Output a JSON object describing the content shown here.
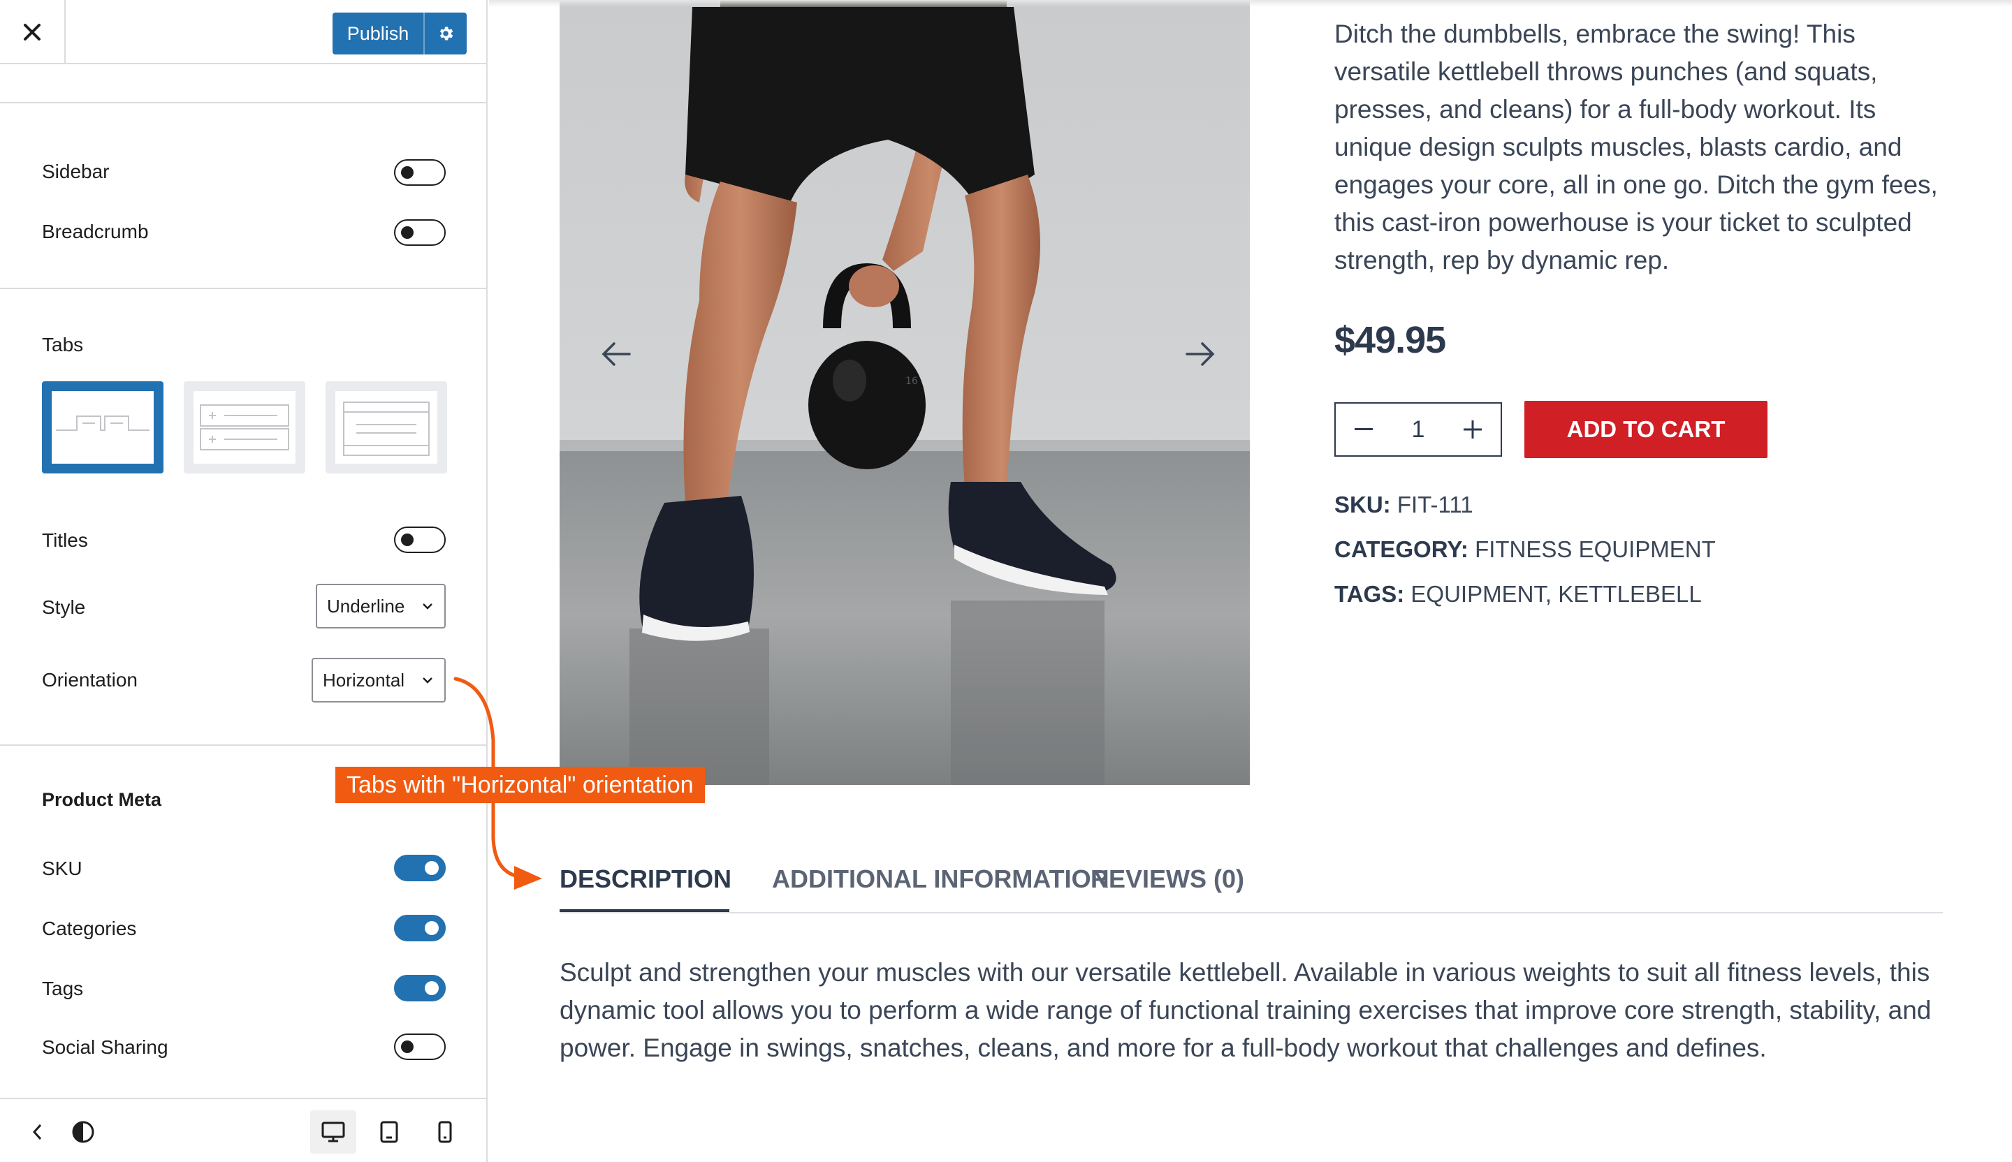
{
  "header": {
    "publish_label": "Publish"
  },
  "sidebar": {
    "sidebar_label": "Sidebar",
    "breadcrumb_label": "Breadcrumb",
    "tabs_title": "Tabs",
    "titles_label": "Titles",
    "style_label": "Style",
    "style_value": "Underline",
    "orientation_label": "Orientation",
    "orientation_value": "Horizontal",
    "product_meta_title": "Product Meta",
    "sku_label": "SKU",
    "categories_label": "Categories",
    "tags_label": "Tags",
    "social_label": "Social Sharing",
    "toggles": {
      "sidebar": false,
      "breadcrumb": false,
      "titles": false,
      "sku": true,
      "categories": true,
      "tags": true,
      "social_sharing": false
    },
    "tabs_layout_selected": 1
  },
  "footer": {
    "active_device": "desktop"
  },
  "product": {
    "description": "Ditch the dumbbells, embrace the swing! This versatile kettlebell throws punches (and squats, presses, and cleans) for a full-body workout. Its unique design sculpts muscles, blasts cardio, and engages your core, all in one go. Ditch the gym fees, this cast-iron powerhouse is your ticket to sculpted strength, rep by dynamic rep.",
    "price": "$49.95",
    "quantity": "1",
    "add_to_cart": "ADD TO CART",
    "sku_key": "SKU:",
    "sku_value": "FIT-111",
    "category_key": "CATEGORY:",
    "category_value": "FITNESS EQUIPMENT",
    "tags_key": "TAGS:",
    "tags_value": "EQUIPMENT, KETTLEBELL",
    "weight_engraving": "16"
  },
  "tabs": {
    "items": [
      "DESCRIPTION",
      "ADDITIONAL INFORMATION",
      "REVIEWS (0)"
    ],
    "active": 0,
    "panel_text": "Sculpt and strengthen your muscles with our versatile kettlebell. Available in various weights to suit all fitness levels, this dynamic tool allows you to perform a wide range of functional training exercises that improve core strength, stability, and power. Engage in swings, snatches, cleans, and more for a full-body workout that challenges and defines."
  },
  "annotation": {
    "text": "Tabs with \"Horizontal\" orientation"
  },
  "colors": {
    "accent": "#2271b1",
    "cart": "#d11f26",
    "callout": "#f15a11",
    "heading": "#2d3a4e"
  }
}
